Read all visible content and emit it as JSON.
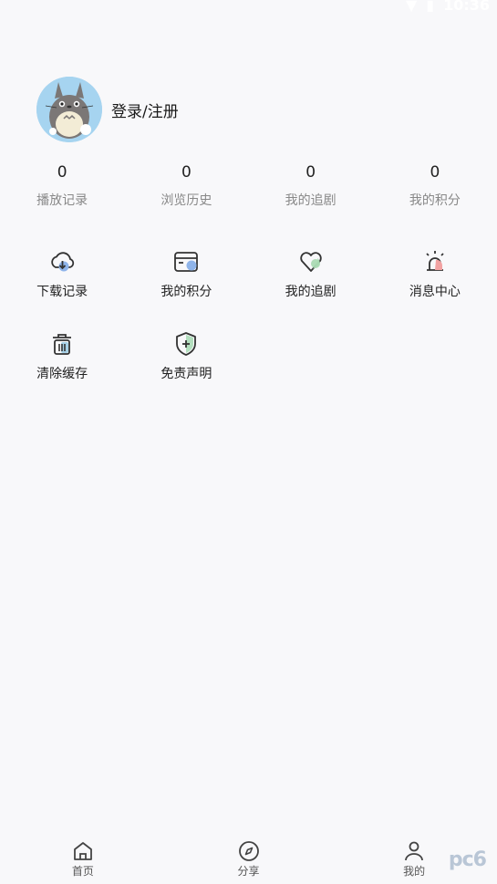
{
  "status_bar": {
    "time": "10:36"
  },
  "profile": {
    "login_label": "登录/注册"
  },
  "stats": [
    {
      "value": "0",
      "label": "播放记录"
    },
    {
      "value": "0",
      "label": "浏览历史"
    },
    {
      "value": "0",
      "label": "我的追剧"
    },
    {
      "value": "0",
      "label": "我的积分"
    }
  ],
  "tools": [
    {
      "label": "下载记录",
      "icon": "cloud-download-icon"
    },
    {
      "label": "我的积分",
      "icon": "card-icon"
    },
    {
      "label": "我的追剧",
      "icon": "heart-icon"
    },
    {
      "label": "消息中心",
      "icon": "alarm-icon"
    },
    {
      "label": "清除缓存",
      "icon": "trash-icon"
    },
    {
      "label": "免责声明",
      "icon": "shield-icon"
    }
  ],
  "tabbar": [
    {
      "label": "首页",
      "icon": "home-icon"
    },
    {
      "label": "分享",
      "icon": "compass-icon"
    },
    {
      "label": "我的",
      "icon": "person-icon"
    }
  ],
  "watermark": "pc6"
}
